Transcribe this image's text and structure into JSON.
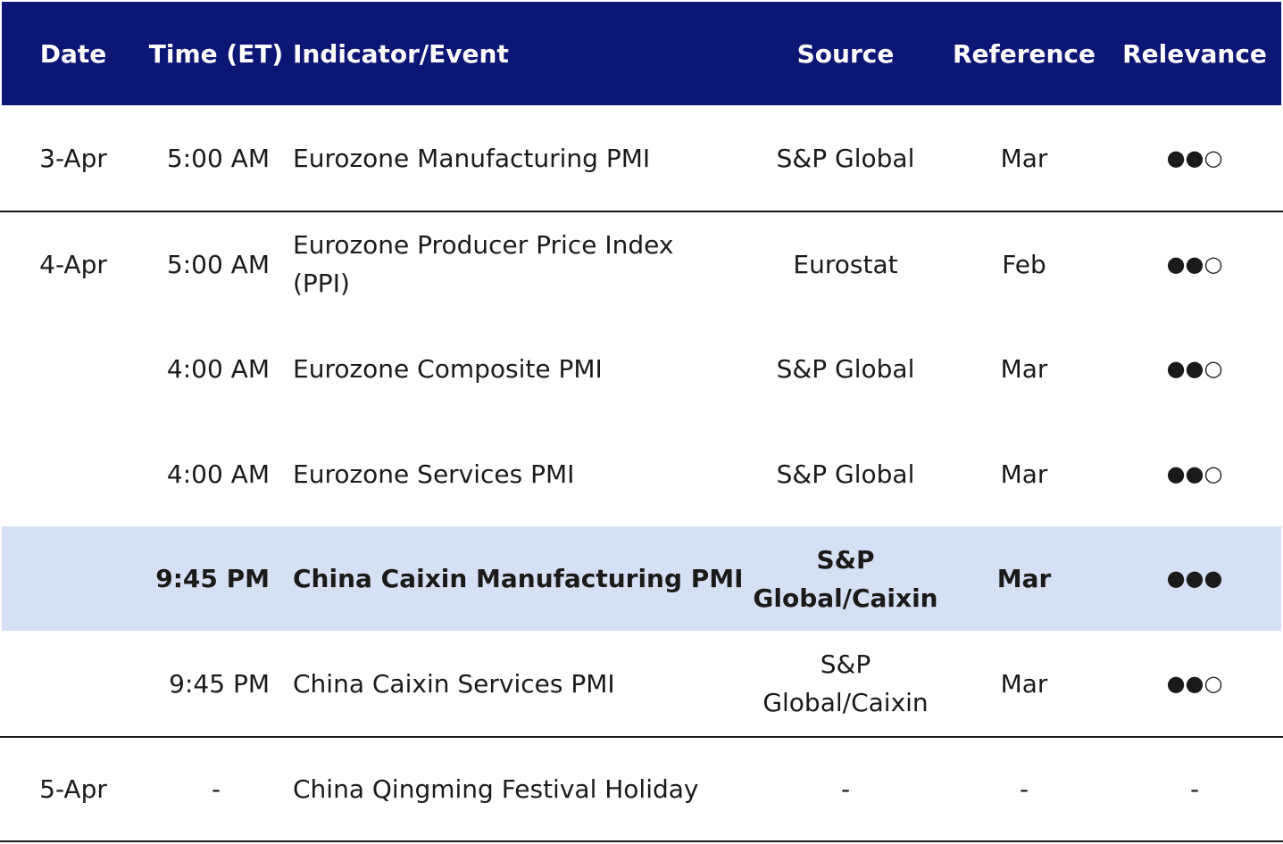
{
  "header": {
    "date": "Date",
    "time": "Time (ET)",
    "event": "Indicator/Event",
    "source": "Source",
    "reference": "Reference",
    "relevance": "Relevance"
  },
  "rows": [
    {
      "date": "3-Apr",
      "time": "5:00 AM",
      "event": "Eurozone Manufacturing PMI",
      "source": "S&P Global",
      "reference": "Mar",
      "relevance": "●●○"
    },
    {
      "date": "4-Apr",
      "time": "5:00 AM",
      "event": "Eurozone Producer Price Index (PPI)",
      "source": "Eurostat",
      "reference": "Feb",
      "relevance": "●●○"
    },
    {
      "date": "",
      "time": "4:00 AM",
      "event": "Eurozone Composite PMI",
      "source": "S&P Global",
      "reference": "Mar",
      "relevance": "●●○"
    },
    {
      "date": "",
      "time": "4:00 AM",
      "event": "Eurozone Services PMI",
      "source": "S&P Global",
      "reference": "Mar",
      "relevance": "●●○"
    },
    {
      "date": "",
      "time": "9:45 PM",
      "event": "China Caixin Manufacturing PMI",
      "source": "S&P Global/Caixin",
      "reference": "Mar",
      "relevance": "●●●"
    },
    {
      "date": "",
      "time": "9:45 PM",
      "event": "China Caixin Services PMI",
      "source": "S&P Global/Caixin",
      "reference": "Mar",
      "relevance": "●●○"
    },
    {
      "date": "5-Apr",
      "time": "-",
      "event": "China Qingming Festival Holiday",
      "source": "-",
      "reference": "-",
      "relevance": "-"
    }
  ],
  "colors": {
    "header_bg": "#0c1674",
    "highlight_bg": "#d6e0f5"
  }
}
